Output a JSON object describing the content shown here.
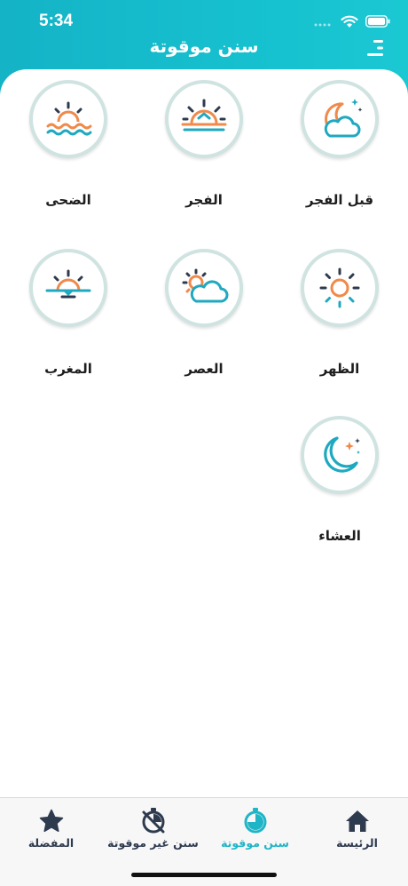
{
  "status": {
    "time": "5:34"
  },
  "header": {
    "title": "سنن موقوتة"
  },
  "tiles": [
    {
      "label": "قبل الفجر",
      "icon": "moon-cloud-icon"
    },
    {
      "label": "الفجر",
      "icon": "sunrise-icon"
    },
    {
      "label": "الضحى",
      "icon": "sun-over-waves-icon"
    },
    {
      "label": "الظهر",
      "icon": "sun-icon"
    },
    {
      "label": "العصر",
      "icon": "sun-behind-cloud-icon"
    },
    {
      "label": "المغرب",
      "icon": "sunset-icon"
    },
    {
      "label": "العشاء",
      "icon": "moon-stars-icon"
    }
  ],
  "tabs": [
    {
      "label": "الرئيسة",
      "icon": "home-icon",
      "active": false
    },
    {
      "label": "سنن موقوتة",
      "icon": "timed-clock-icon",
      "active": true
    },
    {
      "label": "سنن غير موقوتة",
      "icon": "untimed-clock-icon",
      "active": false
    },
    {
      "label": "المفضلة",
      "icon": "star-icon",
      "active": false
    }
  ],
  "colors": {
    "header": "#16bfcf",
    "accent_teal": "#1fa9c0",
    "accent_orange": "#f08a4b",
    "ring": "#cfe3e1",
    "tab_active": "#1fb5c7",
    "tab_inactive": "#2e3a4e"
  }
}
